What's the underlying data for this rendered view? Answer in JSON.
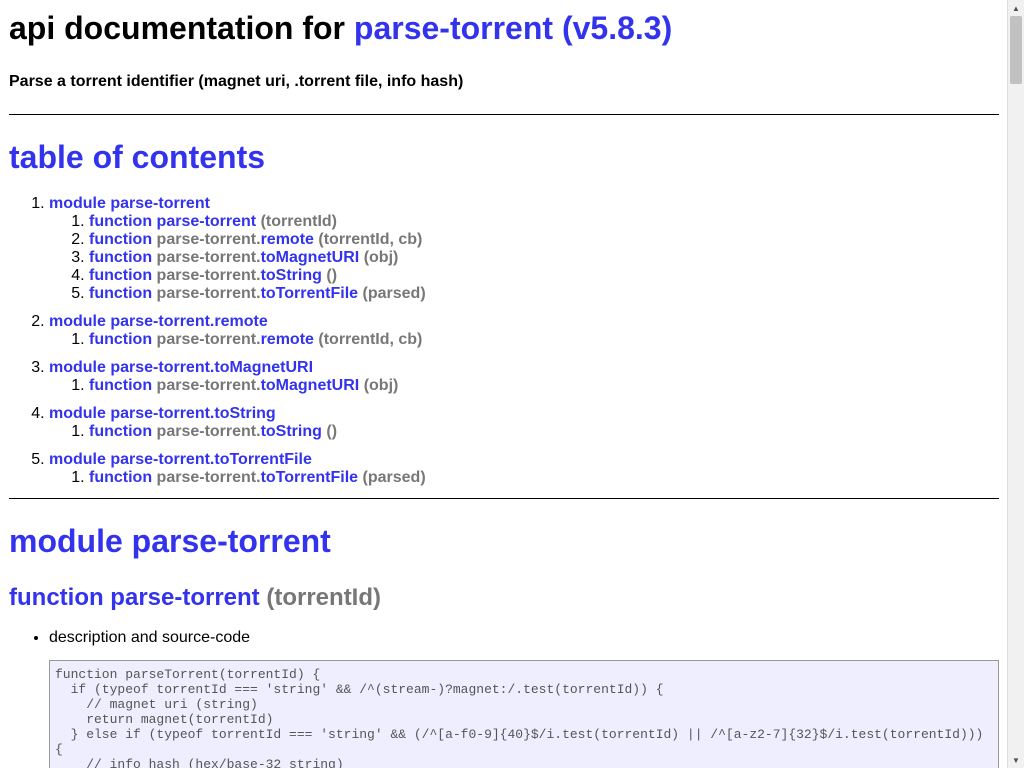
{
  "header": {
    "title_prefix": "api documentation for",
    "title_link": "parse-torrent (v5.8.3)",
    "subtitle": "Parse a torrent identifier (magnet uri, .torrent file, info hash)"
  },
  "toc": {
    "title": "table of contents",
    "modules": [
      {
        "label": "module parse-torrent",
        "functions": [
          {
            "kw": "function",
            "ns": "",
            "name": "parse-torrent",
            "args": "(torrentId)"
          },
          {
            "kw": "function",
            "ns": "parse-torrent.",
            "name": "remote",
            "args": "(torrentId, cb)"
          },
          {
            "kw": "function",
            "ns": "parse-torrent.",
            "name": "toMagnetURI",
            "args": "(obj)"
          },
          {
            "kw": "function",
            "ns": "parse-torrent.",
            "name": "toString",
            "args": "()"
          },
          {
            "kw": "function",
            "ns": "parse-torrent.",
            "name": "toTorrentFile",
            "args": "(parsed)"
          }
        ]
      },
      {
        "label": "module parse-torrent.remote",
        "functions": [
          {
            "kw": "function",
            "ns": "parse-torrent.",
            "name": "remote",
            "args": "(torrentId, cb)"
          }
        ]
      },
      {
        "label": "module parse-torrent.toMagnetURI",
        "functions": [
          {
            "kw": "function",
            "ns": "parse-torrent.",
            "name": "toMagnetURI",
            "args": "(obj)"
          }
        ]
      },
      {
        "label": "module parse-torrent.toString",
        "functions": [
          {
            "kw": "function",
            "ns": "parse-torrent.",
            "name": "toString",
            "args": "()"
          }
        ]
      },
      {
        "label": "module parse-torrent.toTorrentFile",
        "functions": [
          {
            "kw": "function",
            "ns": "parse-torrent.",
            "name": "toTorrentFile",
            "args": "(parsed)"
          }
        ]
      }
    ]
  },
  "module_section": {
    "title": "module parse-torrent",
    "fn_link": "function parse-torrent",
    "fn_args": "(torrentId)",
    "bullet": "description and source-code",
    "code": "function parseTorrent(torrentId) {\n  if (typeof torrentId === 'string' && /^(stream-)?magnet:/.test(torrentId)) {\n    // magnet uri (string)\n    return magnet(torrentId)\n  } else if (typeof torrentId === 'string' && (/^[a-f0-9]{40}$/i.test(torrentId) || /^[a-z2-7]{32}$/i.test(torrentId)))\n{\n    // info hash (hex/base-32 string)"
  },
  "colors": {
    "link": "#3333ee",
    "muted": "#777777",
    "code_bg": "#eeeeff"
  }
}
